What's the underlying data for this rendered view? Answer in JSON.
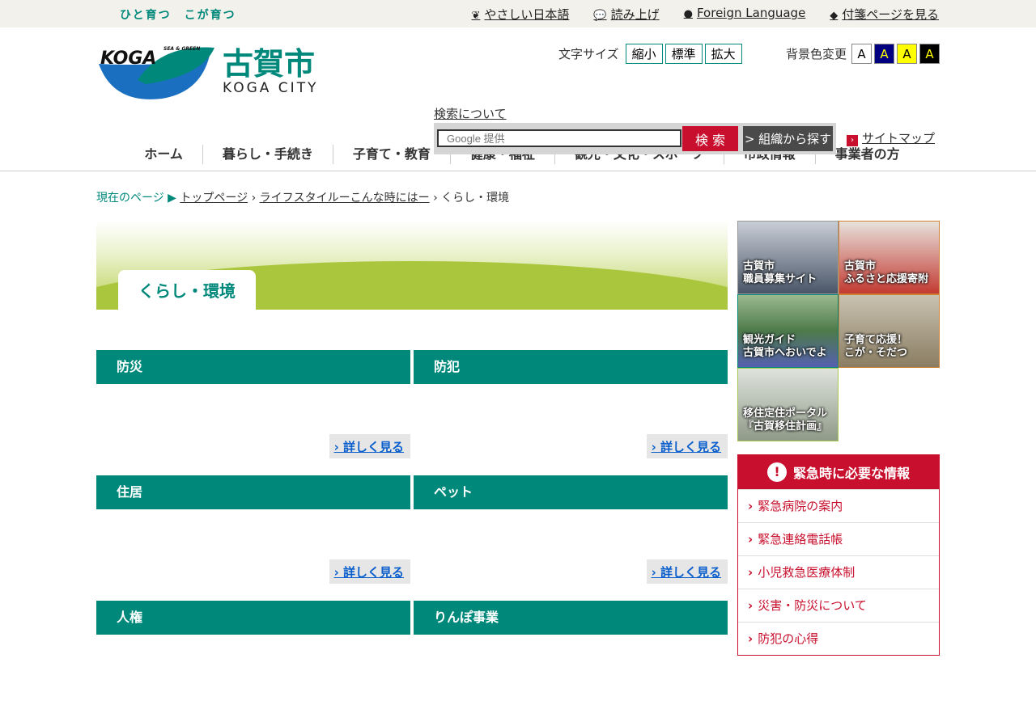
{
  "topbar": {
    "tagline": "ひと育つ　こが育つ",
    "links": [
      {
        "icon": "leaf-icon",
        "label": "やさしい日本語"
      },
      {
        "icon": "speech-bubble-icon",
        "label": "読み上げ"
      },
      {
        "icon": "globe-icon",
        "label": "Foreign Language"
      },
      {
        "icon": "tag-icon",
        "label": "付箋ページを見る"
      }
    ]
  },
  "logo": {
    "koga": "KOGA",
    "sea": "SEA & GREEN",
    "jp": "古賀市",
    "en": "KOGA CITY"
  },
  "font_size": {
    "label": "文字サイズ",
    "options": [
      "縮小",
      "標準",
      "拡大"
    ]
  },
  "bg_color": {
    "label": "背景色変更",
    "options": [
      {
        "label": "A",
        "bg": "#ffffff",
        "fg": "#000000"
      },
      {
        "label": "A",
        "bg": "#000080",
        "fg": "#ffff00"
      },
      {
        "label": "A",
        "bg": "#ffff00",
        "fg": "#000000"
      },
      {
        "label": "A",
        "bg": "#000000",
        "fg": "#ffff00"
      }
    ]
  },
  "search": {
    "about": "検索について",
    "placeholder": "Google 提供",
    "button": "検 索",
    "org_button": "> 組織から探す"
  },
  "sitemap": "サイトマップ",
  "nav": [
    "ホーム",
    "暮らし・手続き",
    "子育て・教育",
    "健康・福祉",
    "観光・文化・スポーツ",
    "市政情報",
    "事業者の方"
  ],
  "breadcrumb": {
    "here": "現在のページ ▶",
    "items": [
      "トップページ",
      "ライフスタイルーこんな時にはー"
    ],
    "current": "くらし・環境"
  },
  "banner_title": "くらし・環境",
  "categories": [
    {
      "title": "防災",
      "more": "詳しく見る"
    },
    {
      "title": "防犯",
      "more": "詳しく見る"
    },
    {
      "title": "住居",
      "more": "詳しく見る"
    },
    {
      "title": "ペット",
      "more": "詳しく見る"
    },
    {
      "title": "人権",
      "more": ""
    },
    {
      "title": "りんぽ事業",
      "more": ""
    }
  ],
  "tiles": [
    {
      "l1": "古賀市",
      "l2": "職員募集サイト",
      "bg": "#4a5668"
    },
    {
      "l1": "古賀市",
      "l2": "ふるさと応援寄附",
      "bg": "#c23a32"
    },
    {
      "l1": "観光ガイド",
      "l2": "古賀市へおいでよ",
      "bg": "#4d7a4a"
    },
    {
      "l1": "子育て応援！",
      "l2": "こが・そだつ",
      "bg": "#8a7d62"
    },
    {
      "l1": "移住定住ポータル",
      "l2": "『古賀移住計画』",
      "bg": "#8f9a88"
    }
  ],
  "emergency": {
    "title": "緊急時に必要な情報",
    "items": [
      "緊急病院の案内",
      "緊急連絡電話帳",
      "小児救急医療体制",
      "災害・防災について",
      "防犯の心得"
    ]
  }
}
